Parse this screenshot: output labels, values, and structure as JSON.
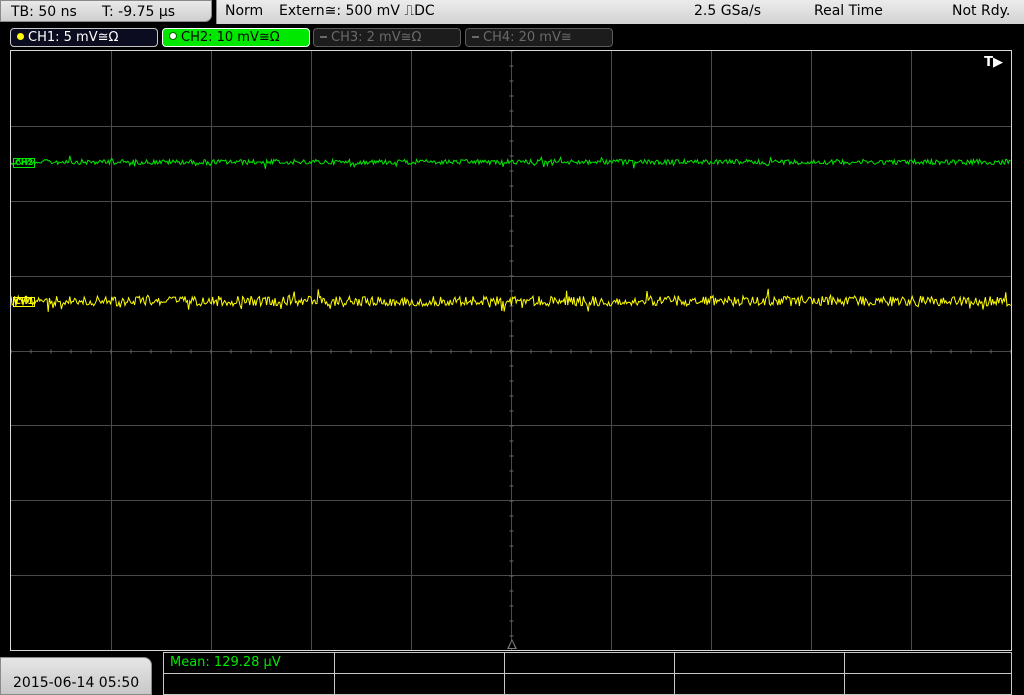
{
  "status": {
    "timebase": "TB: 50 ns",
    "trigger_time": "T: -9.75 µs",
    "acquire_mode": "Norm",
    "trigger_source": "Extern≅: 500 mV ⎍DC",
    "sample_rate": "2.5 GSa/s",
    "sampling_mode": "Real Time",
    "run_state": "Not Rdy."
  },
  "channels": [
    {
      "label": "CH1: 5 mV≅Ω",
      "active": true,
      "color": "#ffff00"
    },
    {
      "label": "CH2: 10 mV≅Ω",
      "active": true,
      "color": "#00e800"
    },
    {
      "label": "CH3: 2 mV≅Ω",
      "active": false,
      "color": "#6a6a6a"
    },
    {
      "label": "CH4: 20 mV≅",
      "active": false,
      "color": "#6a6a6a"
    }
  ],
  "display": {
    "trigger_marker": "T▶",
    "ch1_marker": "CH1",
    "ch2_marker": "CH2"
  },
  "footer": {
    "datetime": "2015-06-14 05:50",
    "measurement": "Mean: 129.28 µV"
  },
  "colors": {
    "ch1": "#ffff00",
    "ch2": "#00e800",
    "grid": "#4a4a4a"
  }
}
